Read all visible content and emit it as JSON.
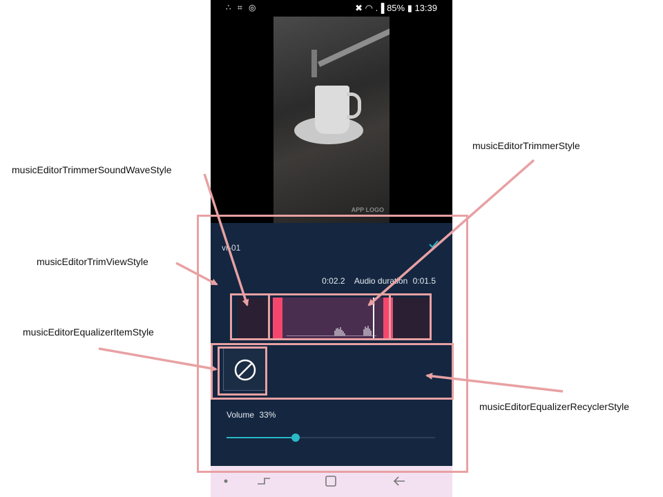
{
  "status_bar": {
    "left_icons": "∴ ⌗ ◎",
    "right_text": "✖ ◠ .▐ 85% ▮ 13:39",
    "battery": "85%",
    "time": "13:39"
  },
  "video": {
    "watermark": "APP LOGO"
  },
  "editor": {
    "track_name": "vr-01",
    "confirm_icon": "check-icon",
    "current_time": "0:02.2",
    "duration_label": "Audio duration",
    "duration_value": "0:01.5",
    "equalizer_items": [
      {
        "icon": "none-icon",
        "selected": true
      }
    ],
    "volume_label": "Volume",
    "volume_value": "33%",
    "volume_fraction": 0.33,
    "accent_color": "#2bb8c7",
    "trim_handle_color": "#f5476d",
    "panel_color": "#142640"
  },
  "nav_bar": {
    "buttons": [
      "dot-icon",
      "recent-apps-icon",
      "home-icon",
      "back-icon"
    ]
  },
  "annotations": {
    "trimmer_sound_wave": "musicEditorTrimmerSoundWaveStyle",
    "trimmer": "musicEditorTrimmerStyle",
    "trim_view": "musicEditorTrimViewStyle",
    "equalizer_item": "musicEditorEqualizerItemStyle",
    "equalizer_recycler": "musicEditorEqualizerRecyclerStyle",
    "color": "#e8a1a3"
  }
}
